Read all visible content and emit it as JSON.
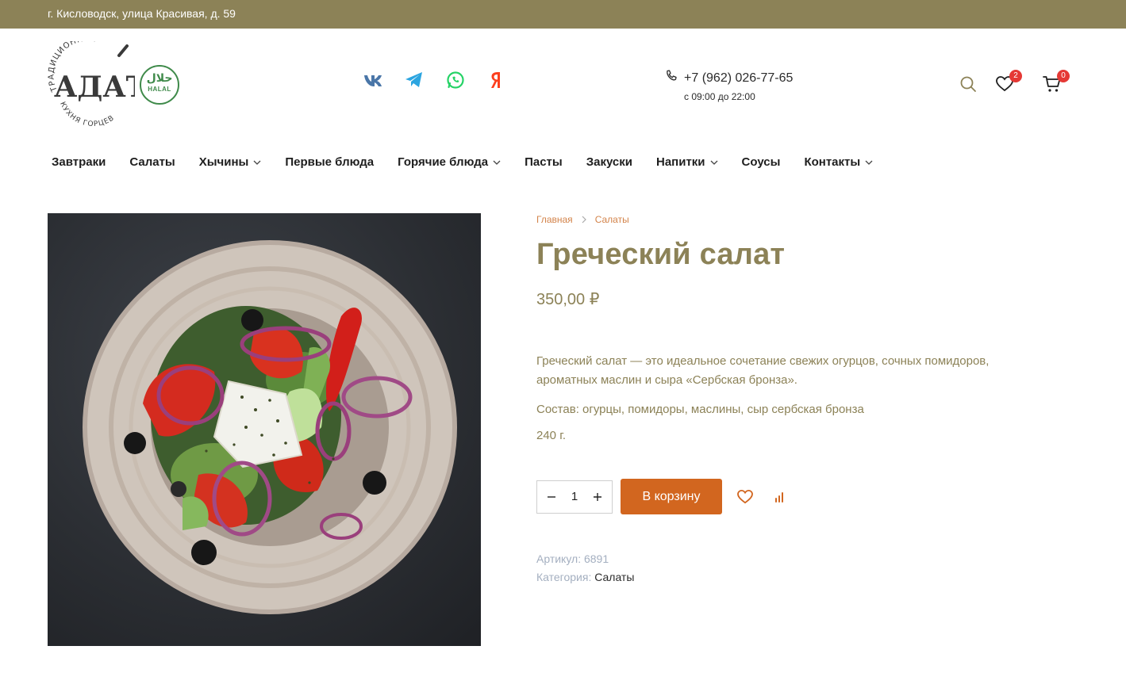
{
  "topbar": {
    "address": "г. Кисловодск, улица Красивая, д. 59"
  },
  "logo": {
    "wordmark": "АДАТ",
    "arc_top": "ТРАДИЦИОННАЯ",
    "arc_bottom": "КУХНЯ ГОРЦЕВ",
    "halal_ar": "حلال",
    "halal_en": "HALAL"
  },
  "socials": [
    {
      "icon": "vk-icon",
      "color": "#4a76a8"
    },
    {
      "icon": "telegram-icon",
      "color": "#2ca5e0"
    },
    {
      "icon": "whatsapp-icon",
      "color": "#25d366"
    },
    {
      "icon": "yandex-icon",
      "color": "#fc3f1d"
    }
  ],
  "contact": {
    "phone": "+7 (962) 026-77-65",
    "hours": "с 09:00 до 22:00"
  },
  "header_icons": {
    "wishlist_count": "2",
    "cart_count": "0"
  },
  "nav": {
    "items": [
      {
        "label": "Завтраки",
        "dropdown": false
      },
      {
        "label": "Салаты",
        "dropdown": false
      },
      {
        "label": "Хычины",
        "dropdown": true
      },
      {
        "label": "Первые блюда",
        "dropdown": false
      },
      {
        "label": "Горячие блюда",
        "dropdown": true
      },
      {
        "label": "Пасты",
        "dropdown": false
      },
      {
        "label": "Закуски",
        "dropdown": false
      },
      {
        "label": "Напитки",
        "dropdown": true
      },
      {
        "label": "Соусы",
        "dropdown": false
      },
      {
        "label": "Контакты",
        "dropdown": true
      }
    ]
  },
  "product": {
    "breadcrumb": [
      "Главная",
      "Салаты"
    ],
    "title": "Греческий салат",
    "price": "350,00 ₽",
    "description": "Греческий салат — это идеальное сочетание свежих огурцов, сочных помидоров, ароматных маслин и сыра «Сербская бронза».",
    "composition": "Состав: огурцы, помидоры, маслины, сыр сербская бронза",
    "weight": "240 г.",
    "quantity": "1",
    "add_to_cart_label": "В корзину",
    "sku_label": "Артикул:",
    "sku": "6891",
    "category_label": "Категория:",
    "category": "Салаты"
  },
  "colors": {
    "brand_olive": "#8c8257",
    "accent_orange": "#d2661f",
    "breadcrumb": "#d3834a",
    "badge": "#e53935",
    "halal_green": "#3f8a4a"
  }
}
